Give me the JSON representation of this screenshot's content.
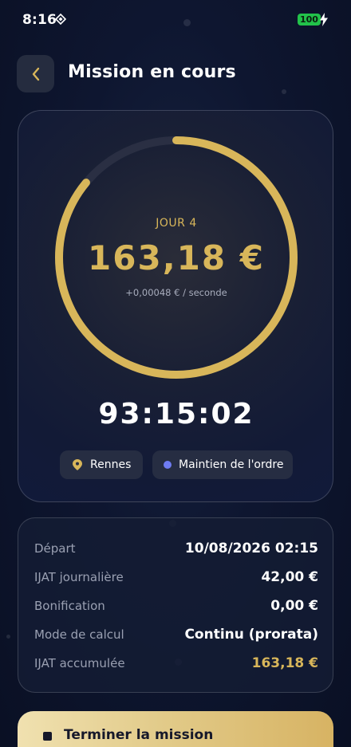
{
  "status_bar": {
    "time": "8:16",
    "battery": "100"
  },
  "header": {
    "title": "Mission en cours",
    "back_icon": "chevron-left-icon"
  },
  "hero": {
    "day_label": "JOUR 4",
    "amount": "163,18 €",
    "rate": "+0,00048 € / seconde",
    "timer": "93:15:02",
    "progress": 0.86,
    "location_chip": "Rennes",
    "unit_chip": "Maintien de l'ordre"
  },
  "info": {
    "rows": [
      {
        "label": "Départ",
        "value": "10/08/2026 02:15"
      },
      {
        "label": "IJAT journalière",
        "value": "42,00 €"
      },
      {
        "label": "Bonification",
        "value": "0,00 €"
      },
      {
        "label": "Mode de calcul",
        "value": "Continu (prorata)"
      },
      {
        "label": "IJAT accumulée",
        "value": "163,18 €"
      }
    ]
  },
  "action": {
    "end_label": "Terminer la mission"
  },
  "colors": {
    "accent_gold": "#d8b65a",
    "background": "#0e1630",
    "chip_dot": "#6f7cf2",
    "battery": "#22c24a"
  }
}
